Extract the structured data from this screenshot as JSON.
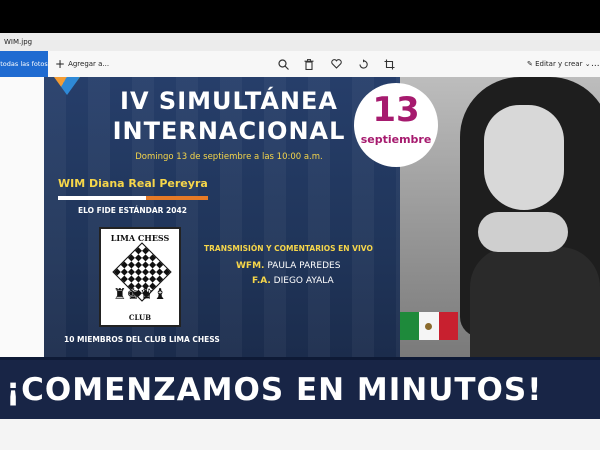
{
  "window": {
    "title": "WIM.jpg"
  },
  "toolbar": {
    "all_photos_label": "todas las fotos",
    "add_label": "Agregar a...",
    "zoom_icon": "zoom-icon",
    "delete_icon": "delete-icon",
    "favorite_icon": "heart-icon",
    "rotate_icon": "rotate-icon",
    "crop_icon": "crop-icon",
    "edit_create_label": "Editar y crear",
    "more_label": "..."
  },
  "poster": {
    "title_line1": "IV SIMULTÁNEA",
    "title_line2": "INTERNACIONAL",
    "date_line": "Domingo 13 de septiembre  a las 10:00 a.m.",
    "player": "WIM Diana Real Pereyra",
    "elo": "ELO FIDE ESTÁNDAR 2042",
    "club_name": "LIMA CHESS",
    "club_word": "CLUB",
    "members": "10 MIEMBROS DEL CLUB LIMA CHESS",
    "stream_title": "TRANSMISIÓN Y COMENTARIOS EN VIVO",
    "commentator1_role": "WFM.",
    "commentator1_name": "PAULA PAREDES",
    "commentator2_role": "F.A.",
    "commentator2_name": "DIEGO AYALA",
    "date_day": "13",
    "date_month": "septiembre",
    "flag_colors": [
      "#1e8a3b",
      "#f5f5f5",
      "#c8202f"
    ]
  },
  "banner": {
    "text": "¡COMENZAMOS EN MINUTOS!"
  }
}
